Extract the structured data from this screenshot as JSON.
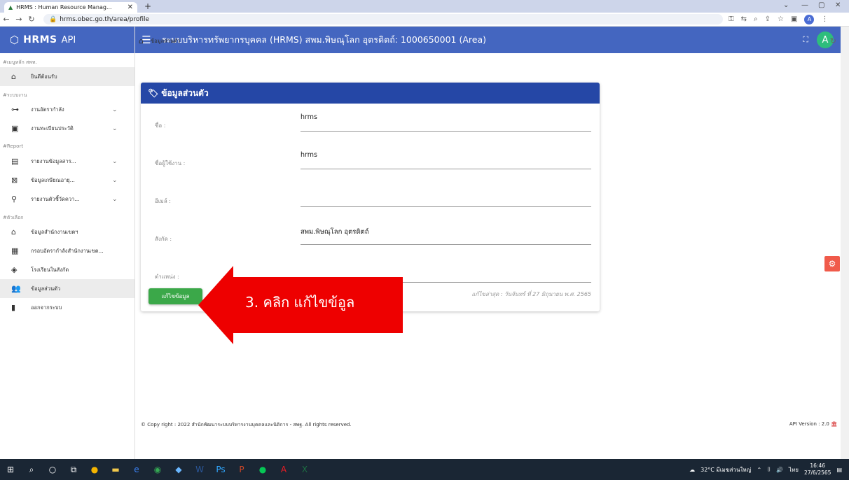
{
  "browser": {
    "tab_title": "HRMS : Human Resource Manag...",
    "url": "hrms.obec.go.th/area/profile",
    "profile_initial": "A"
  },
  "sidebar": {
    "logo": "HRMS",
    "logo_suffix": "API",
    "sections": [
      {
        "title": "#เมนูหลัก สพท.",
        "items": [
          {
            "icon": "home-icon",
            "label": "ยินดีต้อนรับ",
            "chevron": false,
            "active": true
          }
        ]
      },
      {
        "title": "#ระบบงาน",
        "items": [
          {
            "icon": "org-chart-icon",
            "label": "งานอัตรากำลัง",
            "chevron": true
          },
          {
            "icon": "id-card-icon",
            "label": "งานทะเบียนประวัติ",
            "chevron": true
          }
        ]
      },
      {
        "title": "#Report",
        "items": [
          {
            "icon": "report-icon",
            "label": "รายงานข้อมูลสาร...",
            "chevron": true
          },
          {
            "icon": "calendar-x-icon",
            "label": "ข้อมูลเกษียณอายุ...",
            "chevron": true
          },
          {
            "icon": "indicator-icon",
            "label": "รายงานตัวชี้วัดควา...",
            "chevron": true
          }
        ]
      },
      {
        "title": "#ตัวเลือก",
        "items": [
          {
            "icon": "office-icon",
            "label": "ข้อมูลสำนักงานเขตฯ",
            "chevron": false
          },
          {
            "icon": "briefcase-icon",
            "label": "กรอบอัตรากำลังสำนักงานเขต...",
            "chevron": false
          },
          {
            "icon": "school-icon",
            "label": "โรงเรียนในสังกัด",
            "chevron": false
          },
          {
            "icon": "user-profile-icon",
            "label": "ข้อมูลส่วนตัว",
            "chevron": false,
            "active": true
          },
          {
            "icon": "logout-icon",
            "label": "ออกจากระบบ",
            "chevron": false
          }
        ]
      }
    ]
  },
  "header": {
    "title": "ระบบบริหารทรัพยากรบุคคล (HRMS) สพม.พิษณุโลก อุตรดิตถ์: 1000650001 (Area)",
    "avatar": "A"
  },
  "breadcrumb": {
    "current": "ข้อมูลส่วนตัว"
  },
  "card": {
    "title": "ข้อมูลส่วนตัว",
    "fields": [
      {
        "label": "ชื่อ :",
        "value": "hrms"
      },
      {
        "label": "ชื่อผู้ใช้งาน :",
        "value": "hrms"
      },
      {
        "label": "อีเมล์ :",
        "value": ""
      },
      {
        "label": "สังกัด :",
        "value": "สพม.พิษณุโลก อุตรดิตถ์"
      },
      {
        "label": "ตำแหน่ง :",
        "value": ""
      }
    ],
    "edit_button": "แก้ไขข้อมูล",
    "last_edited": "แก้ไขล่าสุด : วันจันทร์ ที่ 27 มิถุนายน พ.ศ. 2565"
  },
  "annotation": {
    "text": "3. คลิก แก้ไขข้อูล",
    "color": "#ee0000"
  },
  "footer": {
    "copyright": "© Copy right : 2022 สำนักพัฒนาระบบบริหารงานบุคคลและนิติการ - สพฐ. All rights reserved.",
    "version": "API Version : 2.0"
  },
  "taskbar": {
    "weather": "32°C มีเมฆส่วนใหญ่",
    "lang": "ไทย",
    "time": "16:46",
    "date": "27/6/2565"
  },
  "colors": {
    "header": "#4466c0",
    "card_header": "#2547a6",
    "button": "#3ba849",
    "fab": "#f05a4a"
  }
}
